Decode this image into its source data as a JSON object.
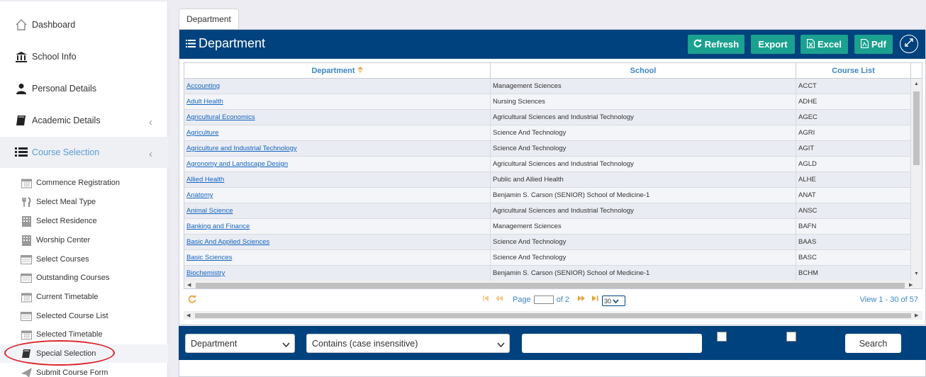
{
  "sidebar": {
    "items": [
      {
        "label": "Dashboard",
        "icon": "home-icon"
      },
      {
        "label": "School Info",
        "icon": "bank-icon"
      },
      {
        "label": "Personal Details",
        "icon": "user-icon"
      },
      {
        "label": "Academic Details",
        "icon": "book-icon"
      },
      {
        "label": "Course Selection",
        "icon": "list-icon"
      }
    ],
    "subitems": [
      {
        "label": "Commence Registration",
        "icon": "calendar-icon"
      },
      {
        "label": "Select Meal Type",
        "icon": "cutlery-icon"
      },
      {
        "label": "Select Residence",
        "icon": "building-icon"
      },
      {
        "label": "Worship Center",
        "icon": "building-icon"
      },
      {
        "label": "Select Courses",
        "icon": "window-icon"
      },
      {
        "label": "Outstanding Courses",
        "icon": "window-icon"
      },
      {
        "label": "Current Timetable",
        "icon": "calendar-icon"
      },
      {
        "label": "Selected Course List",
        "icon": "window-icon"
      },
      {
        "label": "Selected Timetable",
        "icon": "calendar-icon"
      },
      {
        "label": "Special Selection",
        "icon": "book-icon"
      },
      {
        "label": "Submit Course Form",
        "icon": "send-icon"
      }
    ]
  },
  "tab": {
    "label": "Department"
  },
  "panel": {
    "title": "Department",
    "buttons": {
      "refresh": "Refresh",
      "export": "Export",
      "excel": "Excel",
      "pdf": "Pdf"
    }
  },
  "grid": {
    "columns": [
      "Department",
      "School",
      "Course List"
    ],
    "rows": [
      [
        "Accounting",
        "Management Sciences",
        "ACCT"
      ],
      [
        "Adult Health",
        "Nursing Sciences",
        "ADHE"
      ],
      [
        "Agricultural Economics",
        "Agricultural Sciences and Industrial Technology",
        "AGEC"
      ],
      [
        "Agriculture",
        "Science And Technology",
        "AGRI"
      ],
      [
        "Agriculture and Industrial Technology",
        "Science And Technology",
        "AGIT"
      ],
      [
        "Agronomy and Landscape Design",
        "Agricultural Sciences and Industrial Technology",
        "AGLD"
      ],
      [
        "Allied Health",
        "Public and Allied Health",
        "ALHE"
      ],
      [
        "Anatomy",
        "Benjamin S. Carson (SENIOR) School of Medicine-1",
        "ANAT"
      ],
      [
        "Animal Science",
        "Agricultural Sciences and Industrial Technology",
        "ANSC"
      ],
      [
        "Banking and Finance",
        "Management Sciences",
        "BAFN"
      ],
      [
        "Basic And Applied Sciences",
        "Science And Technology",
        "BAAS"
      ],
      [
        "Basic Sciences",
        "Science And Technology",
        "BASC"
      ],
      [
        "Biochemistry",
        "Benjamin S. Carson (SENIOR) School of Medicine-1",
        "BCHM"
      ]
    ]
  },
  "pager": {
    "page_label": "Page",
    "of_label": "of 2",
    "page_size": "30",
    "view_text": "View 1 - 30 of 57"
  },
  "search": {
    "field": "Department",
    "operator": "Contains (case insensitive)",
    "value": "",
    "search_label": "Search"
  },
  "colors": {
    "header": "#00427d",
    "button": "#1aa18f",
    "link": "#1565c0",
    "highlight_circle": "#d9252b"
  }
}
